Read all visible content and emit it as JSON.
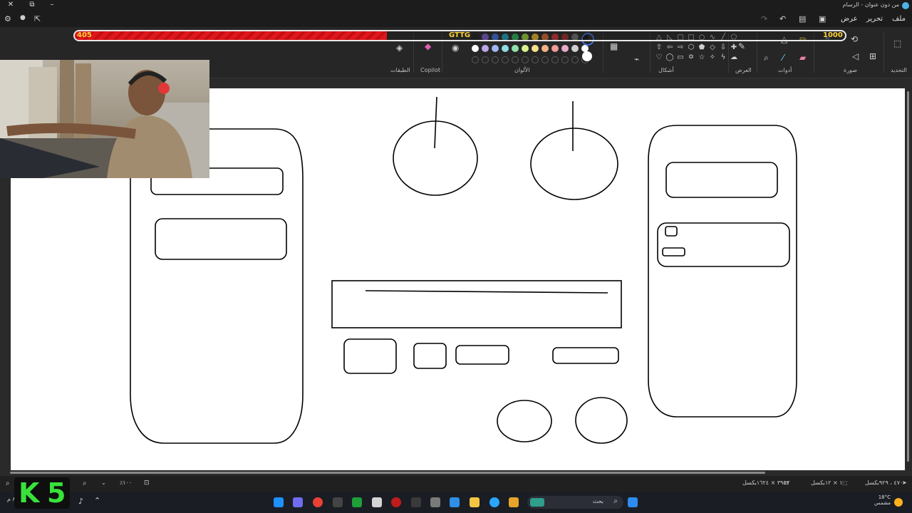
{
  "window": {
    "title": "من دون عنوان - الرسام"
  },
  "menu": {
    "file": "ملف",
    "edit": "تحرير",
    "view": "عرض"
  },
  "ribbon": {
    "groups": {
      "selection": "التحديد",
      "image": "صورة",
      "tools": "أدوات",
      "brushes": "العرض",
      "shapes": "أشكال",
      "colors": "الألوان",
      "copilot": "Copilot",
      "layers": "الطبقات"
    },
    "palette_row1": [
      "#1f1f1f",
      "#7a5cc8",
      "#3c6fd9",
      "#1ea2b8",
      "#2bb35a",
      "#9ccf34",
      "#e6b92b",
      "#d56a2a",
      "#c93434",
      "#9e2a2a",
      "#6d6d6d",
      "#111111"
    ],
    "palette_row2": [
      "#ffffff",
      "#b9a7e8",
      "#9bb6f2",
      "#8fdce6",
      "#8fe0a8",
      "#d9f08c",
      "#f7e08a",
      "#f2b285",
      "#f09a9a",
      "#e8a8c8",
      "#cfcfcf",
      "#ffffff"
    ],
    "selected_color": "#ffffff"
  },
  "overlay": {
    "health_value": "405",
    "health_max": "1000",
    "health_fraction": 0.405,
    "tag": "GTTG"
  },
  "statusbar": {
    "cursor_pos": "٤٧٠ ، ٩٢٩بكسل",
    "selection_size": "١٠ × ١٢بكسل",
    "canvas_size": "٣٩٥٣ × ١٦٢٤بكسل",
    "zoom": "٪١٠٠"
  },
  "taskbar": {
    "search_placeholder": "بحث",
    "weather_temp": "18°C",
    "weather_desc": "مشمس",
    "time": "٨:٠٥ م"
  },
  "logo": {
    "text": "K 5"
  }
}
